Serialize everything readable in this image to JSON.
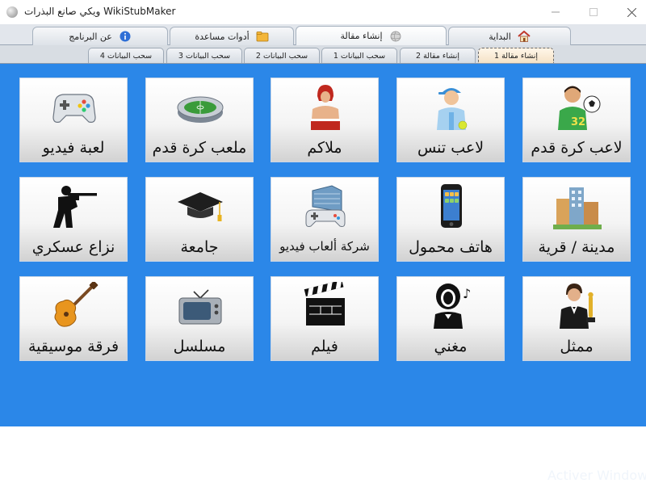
{
  "window": {
    "title": "WikiStubMaker ويكي صانع البذرات"
  },
  "main_tabs": [
    {
      "label": "البداية",
      "icon": "home-icon"
    },
    {
      "label": "إنشاء مقالة",
      "icon": "globe-icon",
      "active": true
    },
    {
      "label": "أدوات مساعدة",
      "icon": "folder-icon"
    },
    {
      "label": "عن البرنامج",
      "icon": "info-icon"
    }
  ],
  "sub_tabs": [
    {
      "label": "إنشاء مقالة 1",
      "active": true
    },
    {
      "label": "إنشاء مقالة 2"
    },
    {
      "label": "سحب البيانات 1"
    },
    {
      "label": "سحب البيانات 2"
    },
    {
      "label": "سحب البيانات 3"
    },
    {
      "label": "سحب البيانات 4"
    }
  ],
  "tiles": [
    {
      "label": "لاعب كرة قدم",
      "icon": "football-player-icon"
    },
    {
      "label": "لاعب تنس",
      "icon": "tennis-player-icon"
    },
    {
      "label": "ملاكم",
      "icon": "boxer-icon"
    },
    {
      "label": "ملعب كرة قدم",
      "icon": "stadium-icon"
    },
    {
      "label": "لعبة فيديو",
      "icon": "gamepad-icon"
    },
    {
      "label": "مدينة / قرية",
      "icon": "city-icon"
    },
    {
      "label": "هاتف محمول",
      "icon": "mobile-phone-icon"
    },
    {
      "label": "شركة ألعاب فيديو",
      "icon": "game-company-icon"
    },
    {
      "label": "جامعة",
      "icon": "graduation-cap-icon"
    },
    {
      "label": "نزاع عسكري",
      "icon": "soldier-icon"
    },
    {
      "label": "ممثل",
      "icon": "actor-oscar-icon"
    },
    {
      "label": "مغني",
      "icon": "singer-icon"
    },
    {
      "label": "فيلم",
      "icon": "clapperboard-icon"
    },
    {
      "label": "مسلسل",
      "icon": "tv-set-icon"
    },
    {
      "label": "فرقة موسيقية",
      "icon": "guitar-icon"
    }
  ],
  "watermark": "Activer Window"
}
